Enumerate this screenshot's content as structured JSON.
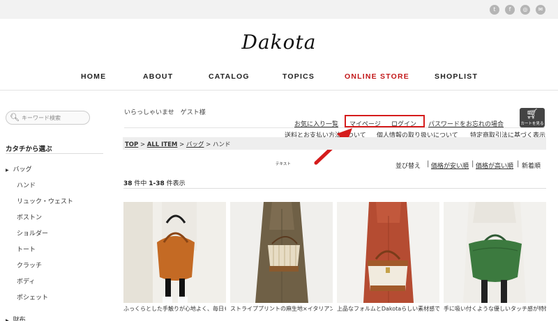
{
  "brand": {
    "logo": "Dakota"
  },
  "social": [
    {
      "icon": "twitter-icon",
      "glyph": "t"
    },
    {
      "icon": "facebook-icon",
      "glyph": "f"
    },
    {
      "icon": "instagram-icon",
      "glyph": "◎"
    },
    {
      "icon": "mail-icon",
      "glyph": "✉"
    }
  ],
  "nav": [
    "HOME",
    "ABOUT",
    "CATALOG",
    "TOPICS",
    "ONLINE STORE",
    "SHOPLIST"
  ],
  "nav_active": "ONLINE STORE",
  "colors": {
    "accent": "#c2181a",
    "highlight": "#d51c1c"
  },
  "sidebar": {
    "search_placeholder": "キーワード検索",
    "category_title": "カタチから選ぶ",
    "parent": "バッグ",
    "items": [
      "ハンド",
      "リュック・ウェスト",
      "ボストン",
      "ショルダー",
      "トート",
      "クラッチ",
      "ボディ",
      "ポシェット"
    ],
    "next_parent": "財布"
  },
  "header": {
    "greeting": "いらっしゃいませ　ゲスト様",
    "favorites": "お気に入り一覧",
    "mypage": "マイページ",
    "login": "ログイン",
    "password": "パスワードをお忘れの場合",
    "shipping": "送料とお支払い方法について",
    "privacy": "個人情報の取り扱いについて",
    "law": "特定商取引法に基づく表示",
    "cart_label": "カートを見る"
  },
  "breadcrumb": {
    "top": "TOP",
    "sep": " > ",
    "all": "ALL ITEM",
    "bag": "バッグ",
    "current": "ハンド"
  },
  "tiny_text": "テキスト",
  "sort": {
    "label": "並び替え",
    "cheap": "価格が安い順",
    "expensive": "価格が高い順",
    "new": "新着順"
  },
  "count": {
    "total": "38",
    "range": "1-38",
    "text_a": " 件中 ",
    "text_b": " 件表示"
  },
  "products": [
    {
      "caption": "ふっくらとした手触りが心地よく、毎日も持ち歩きたくなるバッグシリーズ。Dakotaダ"
    },
    {
      "caption": "ストライププリントの麻生地×イタリアンレザーで、サラリと持てるバッグ。Dakota"
    },
    {
      "caption": "上品なフォルムとDakotaらしい素材感で魅せるマニッシュで小ぶりな2wayハンドバッ"
    },
    {
      "caption": "手に吸い付くような優しいタッチ感が特徴のデイリーユースバッグシリーズ。Dakota"
    }
  ]
}
